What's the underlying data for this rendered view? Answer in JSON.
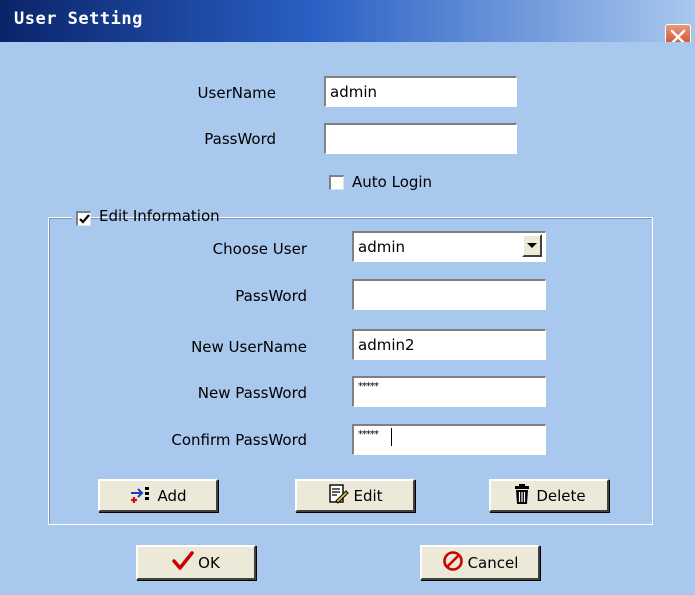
{
  "window": {
    "title": "User Setting"
  },
  "login": {
    "username_label": "UserName",
    "username_value": "admin",
    "password_label": "PassWord",
    "password_value": "",
    "auto_login_label": "Auto Login",
    "auto_login_checked": false
  },
  "edit": {
    "group_label": "Edit Information",
    "group_checked": true,
    "choose_user_label": "Choose User",
    "choose_user_value": "admin",
    "password_label": "PassWord",
    "password_value": "",
    "new_username_label": "New UserName",
    "new_username_value": "admin2",
    "new_password_label": "New PassWord",
    "new_password_value": "*****",
    "confirm_password_label": "Confirm PassWord",
    "confirm_password_value": "*****"
  },
  "buttons": {
    "add": "Add",
    "edit": "Edit",
    "delete": "Delete",
    "ok": "OK",
    "cancel": "Cancel"
  },
  "icons": {
    "close": "close-icon",
    "add": "add-user-icon",
    "edit": "edit-document-icon",
    "delete": "trash-icon",
    "ok": "checkmark-icon",
    "cancel": "prohibited-icon"
  },
  "colors": {
    "dialog_background": "#a9c8ee",
    "titlebar_dark": "#0a246a",
    "ok_check": "#cc0000",
    "cancel_icon": "#cc0000"
  }
}
